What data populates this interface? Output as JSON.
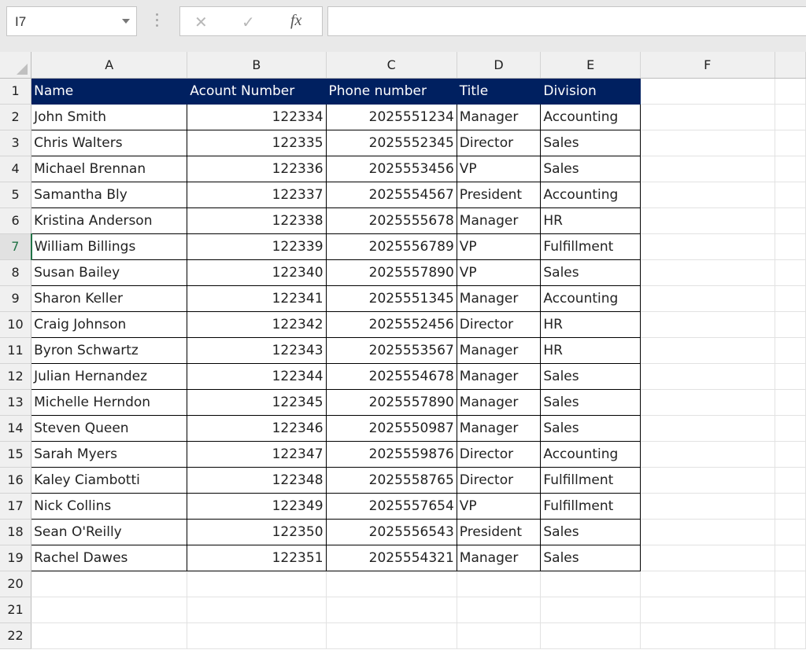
{
  "name_box": "I7",
  "formula_bar": {
    "fx_label": "fx",
    "cancel_glyph": "✕",
    "enter_glyph": "✓",
    "value": ""
  },
  "columns": [
    "A",
    "B",
    "C",
    "D",
    "E",
    "F"
  ],
  "rows": [
    "1",
    "2",
    "3",
    "4",
    "5",
    "6",
    "7",
    "8",
    "9",
    "10",
    "11",
    "12",
    "13",
    "14",
    "15",
    "16",
    "17",
    "18",
    "19",
    "20",
    "21",
    "22"
  ],
  "selected_row": "7",
  "header_fill_color": "#002060",
  "sheet": {
    "headers": [
      "Name",
      "Acount Number",
      "Phone number",
      "Title",
      "Division"
    ],
    "data": [
      [
        "John Smith",
        "122334",
        "2025551234",
        "Manager",
        "Accounting"
      ],
      [
        "Chris Walters",
        "122335",
        "2025552345",
        "Director",
        "Sales"
      ],
      [
        "Michael Brennan",
        "122336",
        "2025553456",
        "VP",
        "Sales"
      ],
      [
        "Samantha Bly",
        "122337",
        "2025554567",
        "President",
        "Accounting"
      ],
      [
        "Kristina Anderson",
        "122338",
        "2025555678",
        "Manager",
        "HR"
      ],
      [
        "William Billings",
        "122339",
        "2025556789",
        "VP",
        "Fulfillment"
      ],
      [
        "Susan Bailey",
        "122340",
        "2025557890",
        "VP",
        "Sales"
      ],
      [
        "Sharon Keller",
        "122341",
        "2025551345",
        "Manager",
        "Accounting"
      ],
      [
        "Craig Johnson",
        "122342",
        "2025552456",
        "Director",
        "HR"
      ],
      [
        "Byron Schwartz",
        "122343",
        "2025553567",
        "Manager",
        "HR"
      ],
      [
        "Julian Hernandez",
        "122344",
        "2025554678",
        "Manager",
        "Sales"
      ],
      [
        "Michelle Herndon",
        "122345",
        "2025557890",
        "Manager",
        "Sales"
      ],
      [
        "Steven Queen",
        "122346",
        "2025550987",
        "Manager",
        "Sales"
      ],
      [
        "Sarah Myers",
        "122347",
        "2025559876",
        "Director",
        "Accounting"
      ],
      [
        "Kaley Ciambotti",
        "122348",
        "2025558765",
        "Director",
        "Fulfillment"
      ],
      [
        "Nick Collins",
        "122349",
        "2025557654",
        "VP",
        "Fulfillment"
      ],
      [
        "Sean O'Reilly",
        "122350",
        "2025556543",
        "President",
        "Sales"
      ],
      [
        "Rachel Dawes",
        "122351",
        "2025554321",
        "Manager",
        "Sales"
      ]
    ]
  }
}
